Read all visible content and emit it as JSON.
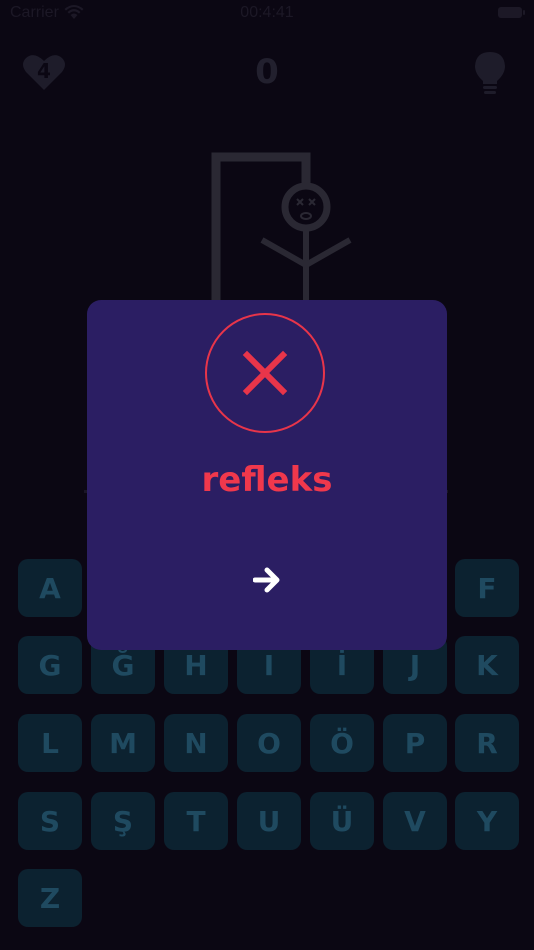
{
  "status_bar": {
    "carrier": "Carrier",
    "time": "00:4:41"
  },
  "header": {
    "lives": "4",
    "score": "0",
    "heart_icon": "heart-icon",
    "hint_icon": "lightbulb-icon"
  },
  "keyboard": {
    "row1": [
      "A",
      "F"
    ],
    "row2": [
      "G",
      "Ğ",
      "H",
      "I",
      "İ",
      "J",
      "K"
    ],
    "row3": [
      "L",
      "M",
      "N",
      "O",
      "Ö",
      "P",
      "R"
    ],
    "row4": [
      "S",
      "Ş",
      "T",
      "U",
      "Ü",
      "V",
      "Y"
    ],
    "row5": [
      "Z"
    ]
  },
  "modal": {
    "result_icon": "close-icon",
    "answer": "refleks",
    "next_icon": "arrow-right-icon"
  },
  "colors": {
    "background": "#0b0713",
    "modal": "#2b1e63",
    "error_red": "#e8354a",
    "key_bg": "#0c2230",
    "key_text": "#1f4a60"
  }
}
